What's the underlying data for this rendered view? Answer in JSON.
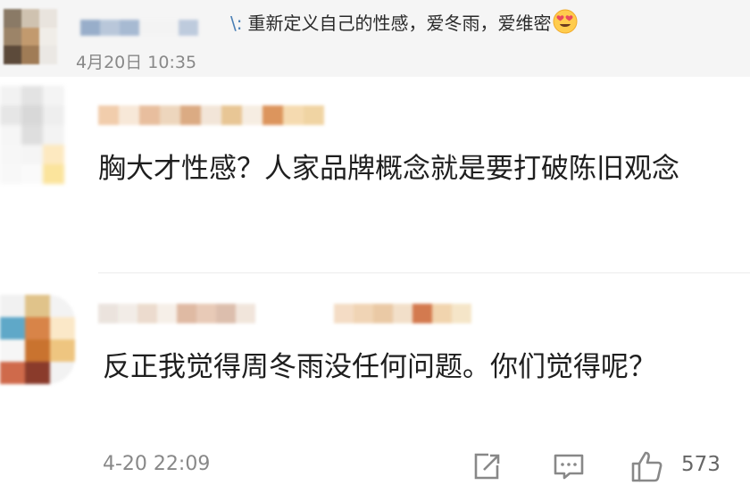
{
  "top_post": {
    "quote_prefix": "\\:",
    "quote_text": "重新定义自己的性感，爱冬雨，爱维密",
    "emoji_icon": "heart-eyes-icon",
    "time": "4月20日 10:35",
    "avatar_colors": [
      "#8a7a66",
      "#cfc2b0",
      "#e9e4de",
      "#9c8468",
      "#c29a6e",
      "#f0ede8",
      "#5c4a3a",
      "#a07c56",
      "#ebe8e4"
    ],
    "name_colors": [
      "#8fa7c6",
      "#b3c3d8",
      "#9fb4cf",
      "#f3f3f3",
      "#f3f3f3",
      "#b9c7db"
    ]
  },
  "comment_1": {
    "text": "胸大才性感？人家品牌概念就是要打破陈旧观念",
    "avatar_colors": [
      "#f2f2f2",
      "#e3e3e3",
      "#f4f4f4",
      "#e6e6e6",
      "#d8d8d8",
      "#eeeeee",
      "#f6f6f6",
      "#dedede",
      "#f3f3f3",
      "#f7f7f7",
      "#f5f5f5",
      "#fde9c0",
      "#f8f8f8",
      "#fafafa",
      "#fbe49c"
    ],
    "name_colors": [
      "#f0c8a4",
      "#f7e6d4",
      "#e6b894",
      "#ecd2b6",
      "#d8a276",
      "#f1e3d4",
      "#e6c08a",
      "#f6ecdf",
      "#d98a4c",
      "#f4d7a8",
      "#efd09a"
    ]
  },
  "comment_2": {
    "text": "反正我觉得周冬雨没任何问题。你们觉得呢？",
    "time": "4-20 22:09",
    "like_count": "573",
    "avatar_colors": [
      "#f1f1f1",
      "#e0c38a",
      "#f3f3f3",
      "#5fa8c8",
      "#d88448",
      "#fbe8c8",
      "#f6f6f6",
      "#c9732f",
      "#eec580",
      "#cf6a4b",
      "#8a3b2b",
      "#f2f2f2"
    ],
    "name_colors": [
      "#e9e1da",
      "#f1ebe5",
      "#ead8c9",
      "#f6eee6",
      "#dcb39a",
      "#e6c5b0",
      "#d9b8a5",
      "#f0e3d8",
      "#ffffff",
      "#ffffff",
      "#ffffff",
      "#ffffff",
      "#f3d9bf",
      "#efd0ad",
      "#e8c49c",
      "#f1dcc4",
      "#cf6c3c",
      "#f0d0a6",
      "#f4e3c3"
    ]
  },
  "actions": [
    "share-icon",
    "comment-icon",
    "like-icon"
  ]
}
